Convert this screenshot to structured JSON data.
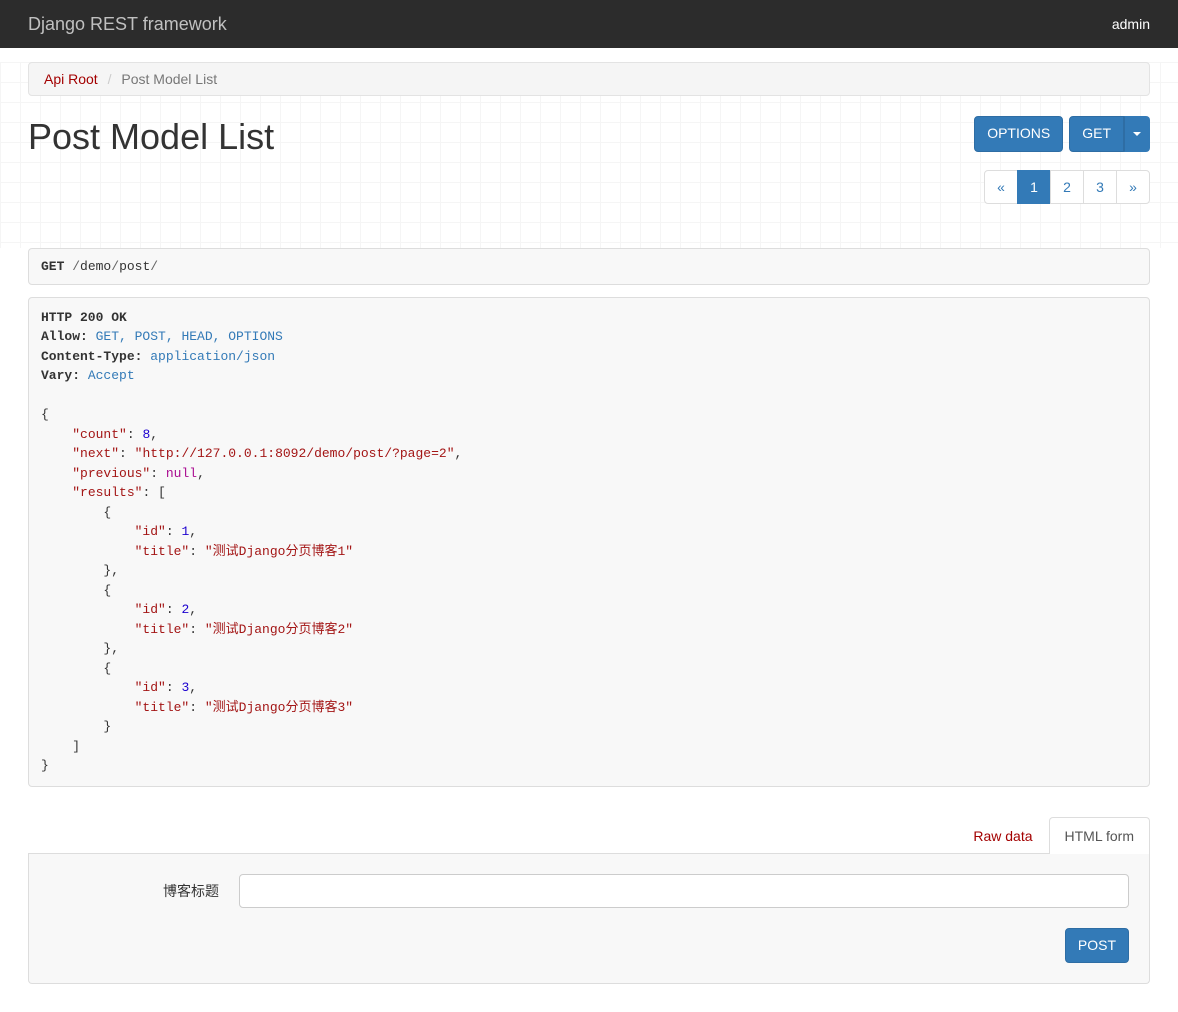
{
  "navbar": {
    "brand": "Django REST framework",
    "user": "admin"
  },
  "breadcrumb": {
    "root": "Api Root",
    "current": "Post Model List"
  },
  "page_title": "Post Model List",
  "buttons": {
    "options": "OPTIONS",
    "get": "GET",
    "post": "POST"
  },
  "pagination": {
    "prev": "«",
    "pages": [
      "1",
      "2",
      "3"
    ],
    "next": "»",
    "active": 0
  },
  "request": {
    "method": "GET",
    "path_parts": [
      "/",
      "demo",
      "/",
      "post",
      "/"
    ]
  },
  "response": {
    "status": "HTTP 200 OK",
    "headers": {
      "allow_label": "Allow:",
      "allow_value": "GET, POST, HEAD, OPTIONS",
      "ctype_label": "Content-Type:",
      "ctype_value": "application/json",
      "vary_label": "Vary:",
      "vary_value": "Accept"
    },
    "body": {
      "count": 8,
      "next": "http://127.0.0.1:8092/demo/post/?page=2",
      "previous": null,
      "results": [
        {
          "id": 1,
          "title": "测试Django分页博客1"
        },
        {
          "id": 2,
          "title": "测试Django分页博客2"
        },
        {
          "id": 3,
          "title": "测试Django分页博客3"
        }
      ]
    }
  },
  "tabs": {
    "raw": "Raw data",
    "html": "HTML form"
  },
  "form": {
    "label": "博客标题"
  }
}
